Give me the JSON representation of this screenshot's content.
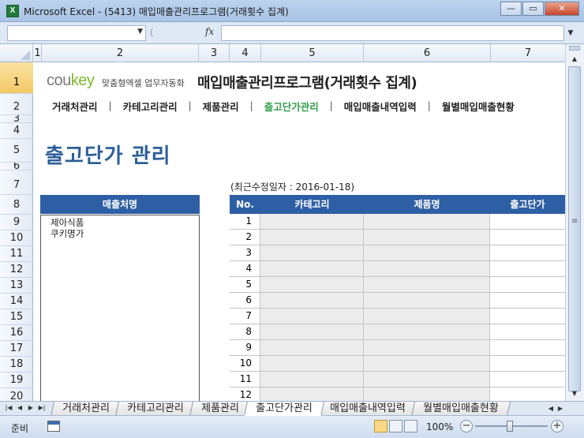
{
  "window": {
    "title": "Microsoft Excel - (5413) 매입매출관리프로그램(거래횟수 집계)",
    "app_icon": "X",
    "buttons": {
      "minimize": "—",
      "restore": "▭",
      "close": "✕"
    }
  },
  "formula_bar": {
    "name_box": "",
    "fx": "fx",
    "formula": ""
  },
  "columns": [
    "1",
    "2",
    "3",
    "4",
    "5",
    "6",
    "7"
  ],
  "rows": [
    "1",
    "2",
    "3",
    "4",
    "5",
    "6",
    "7",
    "8",
    "9",
    "10",
    "11",
    "12",
    "13",
    "14",
    "15",
    "16",
    "17",
    "18",
    "19",
    "20"
  ],
  "header": {
    "brand": "cou",
    "brand_accent": "key",
    "brand_sub": "맞춤형엑셀 업무자동화",
    "app_title": "매입매출관리프로그램(거래횟수 집계)"
  },
  "nav": {
    "items": [
      "거래처관리",
      "카테고리관리",
      "제품관리",
      "출고단가관리",
      "매입매출내역입력",
      "월별매입매출현황"
    ],
    "separator": "|",
    "current_index": 3
  },
  "page": {
    "heading": "출고단가 관리",
    "revision": "(최근수정일자 : 2016-01-18)"
  },
  "customers": {
    "header": "매출처명",
    "items": [
      "제아식품",
      "쿠키명가"
    ]
  },
  "price_table": {
    "headers": {
      "no": "No.",
      "category": "카테고리",
      "product": "제품명",
      "price": "출고단가"
    },
    "rows": [
      {
        "no": "1"
      },
      {
        "no": "2"
      },
      {
        "no": "3"
      },
      {
        "no": "4"
      },
      {
        "no": "5"
      },
      {
        "no": "6"
      },
      {
        "no": "7"
      },
      {
        "no": "8"
      },
      {
        "no": "9"
      },
      {
        "no": "10"
      },
      {
        "no": "11"
      },
      {
        "no": "12"
      }
    ]
  },
  "sheet_tabs": [
    "거래처관리",
    "카테고리관리",
    "제품관리",
    "출고단가관리",
    "매입매출내역입력",
    "월별매입매출현황"
  ],
  "active_tab": 3,
  "status": {
    "ready": "준비",
    "zoom": "100%",
    "zoom_minus": "−",
    "zoom_plus": "+"
  },
  "colors": {
    "header_blue": "#2e5fa5",
    "heading_blue": "#2d5f98",
    "nav_active_green": "#2f9d49",
    "brand_green": "#7cb82f"
  }
}
